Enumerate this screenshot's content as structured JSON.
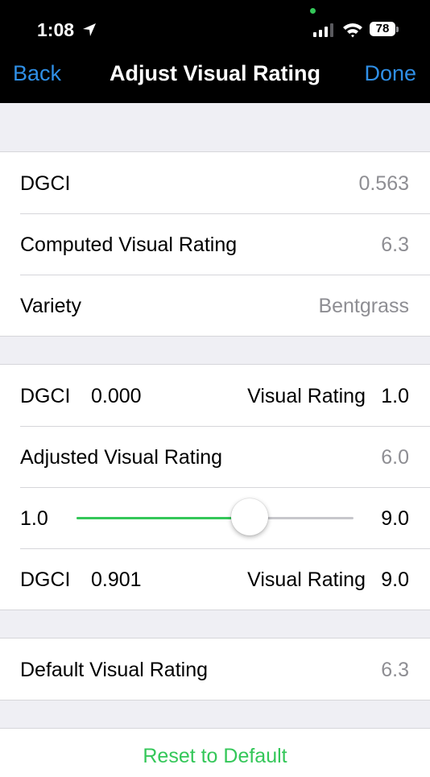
{
  "status_bar": {
    "time": "1:08",
    "battery": "78"
  },
  "nav": {
    "back_label": "Back",
    "title": "Adjust Visual Rating",
    "done_label": "Done"
  },
  "info_group": [
    {
      "label": "DGCI",
      "value": "0.563"
    },
    {
      "label": "Computed Visual Rating",
      "value": "6.3"
    },
    {
      "label": "Variety",
      "value": "Bentgrass"
    }
  ],
  "adjust_group": {
    "min_row": {
      "dgci_label": "DGCI",
      "dgci_value": "0.000",
      "rating_label": "Visual Rating",
      "rating_value": "1.0"
    },
    "adjusted": {
      "label": "Adjusted Visual Rating",
      "value": "6.0"
    },
    "slider": {
      "min_label": "1.0",
      "max_label": "9.0",
      "min": 1.0,
      "max": 9.0,
      "value": 6.0
    },
    "max_row": {
      "dgci_label": "DGCI",
      "dgci_value": "0.901",
      "rating_label": "Visual Rating",
      "rating_value": "9.0"
    }
  },
  "default_group": {
    "label": "Default Visual Rating",
    "value": "6.3"
  },
  "reset_label": "Reset to Default",
  "colors": {
    "accent_blue": "#2f8fe6",
    "accent_green": "#34c759",
    "secondary_text": "#8e8e93",
    "background": "#efeff4"
  }
}
